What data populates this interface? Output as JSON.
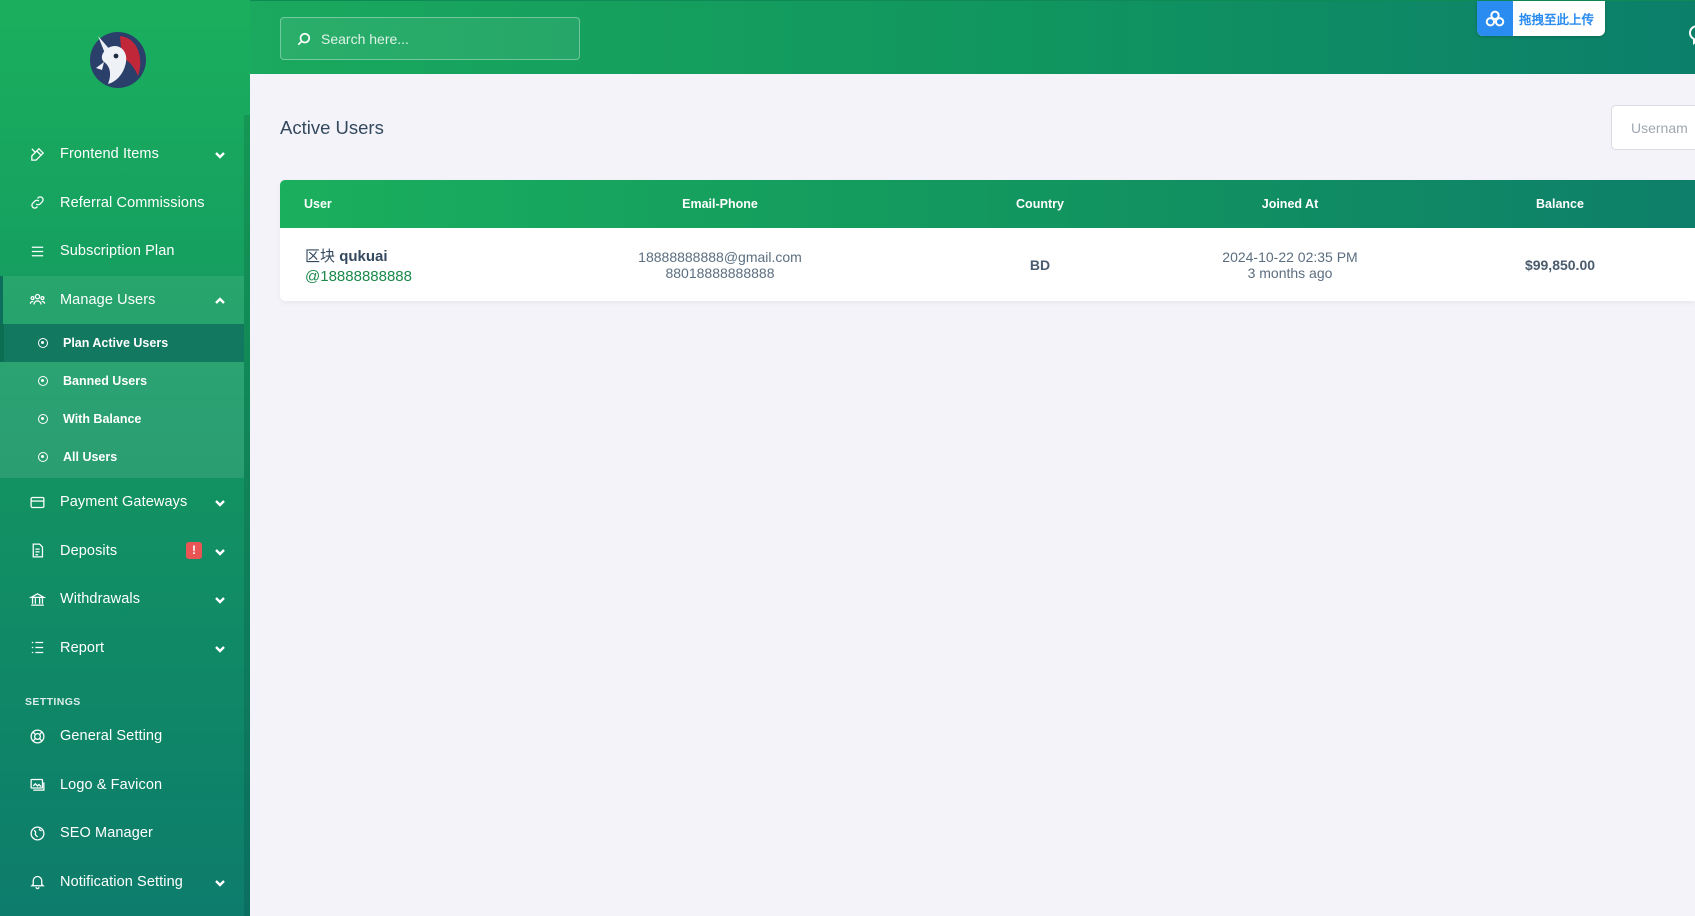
{
  "sidebar": {
    "items_top": [
      {
        "label": "Frontend Items",
        "icon": "tools-icon",
        "chevron": "down"
      },
      {
        "label": "Referral Commissions",
        "icon": "link-icon",
        "chevron": ""
      },
      {
        "label": "Subscription Plan",
        "icon": "menu-lines-icon",
        "chevron": ""
      },
      {
        "label": "Manage Users",
        "icon": "users-icon",
        "chevron": "up"
      }
    ],
    "submenu": [
      {
        "label": "Plan Active Users",
        "active": true
      },
      {
        "label": "Banned Users"
      },
      {
        "label": "With Balance"
      },
      {
        "label": "All Users"
      }
    ],
    "items_bottom": [
      {
        "label": "Payment Gateways",
        "icon": "credit-card-icon"
      },
      {
        "label": "Deposits",
        "icon": "receipt-icon",
        "badge": "!"
      },
      {
        "label": "Withdrawals",
        "icon": "bank-icon"
      },
      {
        "label": "Report",
        "icon": "list-icon"
      }
    ],
    "settings_title": "SETTINGS",
    "settings_items": [
      {
        "label": "General Setting",
        "icon": "lifebuoy-icon"
      },
      {
        "label": "Logo & Favicon",
        "icon": "images-icon"
      },
      {
        "label": "SEO Manager",
        "icon": "globe-icon"
      },
      {
        "label": "Notification Setting",
        "icon": "bell-icon"
      }
    ]
  },
  "topbar": {
    "search_placeholder": "Search here...",
    "upload_label": "拖拽至此上传"
  },
  "main": {
    "title": "Active Users",
    "username_placeholder": "Usernam",
    "table": {
      "headers": [
        "User",
        "Email-Phone",
        "Country",
        "Joined At",
        "Balance"
      ],
      "rows": [
        {
          "name_prefix": "区块",
          "name": "qukuai",
          "handle": "@18888888888",
          "email": "18888888888@gmail.com",
          "phone": "88018888888888",
          "country": "BD",
          "joined": "2024-10-22 02:35 PM",
          "joined_ago": "3 months ago",
          "balance": "$99,850.00"
        }
      ]
    }
  },
  "colors": {
    "brand_green": "#1aaf5d",
    "brand_teal": "#0d7c6c",
    "alert_red": "#ea5455",
    "upload_blue": "#2a8cf0"
  }
}
